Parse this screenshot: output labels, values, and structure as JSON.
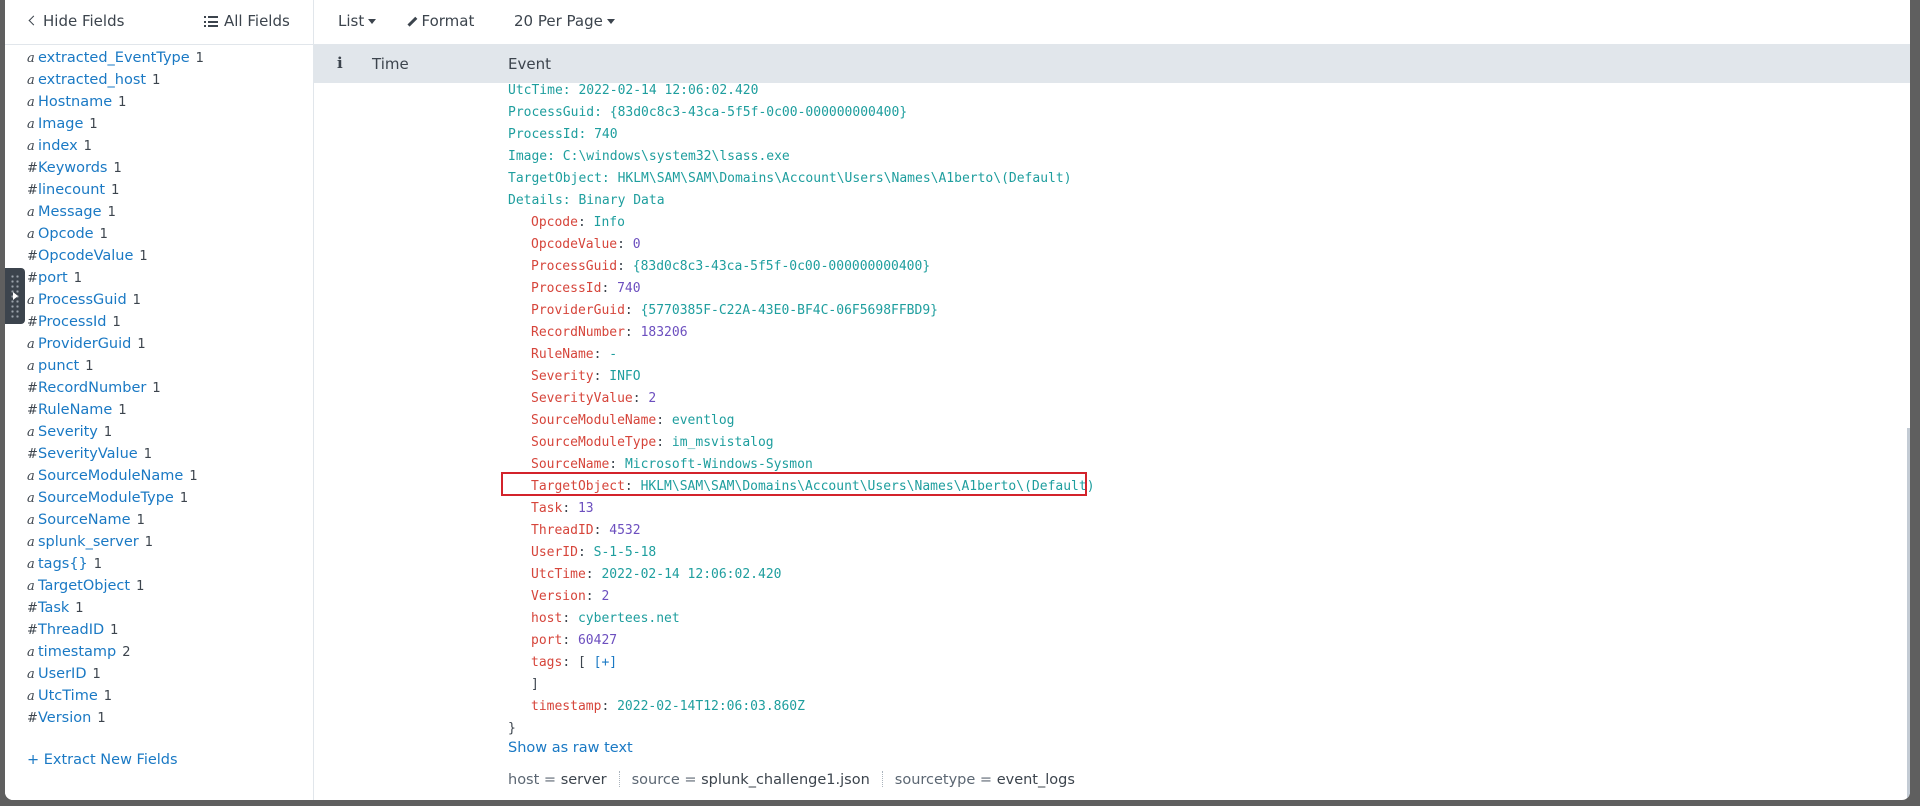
{
  "sidebar": {
    "hide_fields_label": "Hide Fields",
    "all_fields_label": "All Fields",
    "extract_label": "+ Extract New Fields",
    "fields": [
      {
        "type": "a",
        "name": "extracted_EventType",
        "count": "1"
      },
      {
        "type": "a",
        "name": "extracted_host",
        "count": "1"
      },
      {
        "type": "a",
        "name": "Hostname",
        "count": "1"
      },
      {
        "type": "a",
        "name": "Image",
        "count": "1"
      },
      {
        "type": "a",
        "name": "index",
        "count": "1"
      },
      {
        "type": "#",
        "name": "Keywords",
        "count": "1"
      },
      {
        "type": "#",
        "name": "linecount",
        "count": "1"
      },
      {
        "type": "a",
        "name": "Message",
        "count": "1"
      },
      {
        "type": "a",
        "name": "Opcode",
        "count": "1"
      },
      {
        "type": "#",
        "name": "OpcodeValue",
        "count": "1"
      },
      {
        "type": "#",
        "name": "port",
        "count": "1"
      },
      {
        "type": "a",
        "name": "ProcessGuid",
        "count": "1"
      },
      {
        "type": "#",
        "name": "ProcessId",
        "count": "1"
      },
      {
        "type": "a",
        "name": "ProviderGuid",
        "count": "1"
      },
      {
        "type": "a",
        "name": "punct",
        "count": "1"
      },
      {
        "type": "#",
        "name": "RecordNumber",
        "count": "1"
      },
      {
        "type": "#",
        "name": "RuleName",
        "count": "1"
      },
      {
        "type": "a",
        "name": "Severity",
        "count": "1"
      },
      {
        "type": "#",
        "name": "SeverityValue",
        "count": "1"
      },
      {
        "type": "a",
        "name": "SourceModuleName",
        "count": "1"
      },
      {
        "type": "a",
        "name": "SourceModuleType",
        "count": "1"
      },
      {
        "type": "a",
        "name": "SourceName",
        "count": "1"
      },
      {
        "type": "a",
        "name": "splunk_server",
        "count": "1"
      },
      {
        "type": "a",
        "name": "tags{}",
        "count": "1"
      },
      {
        "type": "a",
        "name": "TargetObject",
        "count": "1"
      },
      {
        "type": "#",
        "name": "Task",
        "count": "1"
      },
      {
        "type": "#",
        "name": "ThreadID",
        "count": "1"
      },
      {
        "type": "a",
        "name": "timestamp",
        "count": "2"
      },
      {
        "type": "a",
        "name": "UserID",
        "count": "1"
      },
      {
        "type": "a",
        "name": "UtcTime",
        "count": "1"
      },
      {
        "type": "#",
        "name": "Version",
        "count": "1"
      }
    ]
  },
  "toolbar": {
    "list_label": "List",
    "format_label": "Format",
    "per_page_label": "20 Per Page"
  },
  "table_header": {
    "info_label": "i",
    "time_label": "Time",
    "event_label": "Event"
  },
  "event": {
    "plain_lines": [
      "UtcTime: 2022-02-14 12:06:02.420",
      "ProcessGuid: {83d0c8c3-43ca-5f5f-0c00-000000000400}",
      "ProcessId: 740",
      "Image: C:\\windows\\system32\\lsass.exe",
      "TargetObject: HKLM\\SAM\\SAM\\Domains\\Account\\Users\\Names\\A1berto\\(Default)",
      "Details: Binary Data"
    ],
    "kv_lines": [
      {
        "key": "Opcode",
        "value": "Info",
        "vtype": "s"
      },
      {
        "key": "OpcodeValue",
        "value": "0",
        "vtype": "n"
      },
      {
        "key": "ProcessGuid",
        "value": "{83d0c8c3-43ca-5f5f-0c00-000000000400}",
        "vtype": "s"
      },
      {
        "key": "ProcessId",
        "value": "740",
        "vtype": "n"
      },
      {
        "key": "ProviderGuid",
        "value": "{5770385F-C22A-43E0-BF4C-06F5698FFBD9}",
        "vtype": "s"
      },
      {
        "key": "RecordNumber",
        "value": "183206",
        "vtype": "n"
      },
      {
        "key": "RuleName",
        "value": "-",
        "vtype": "s"
      },
      {
        "key": "Severity",
        "value": "INFO",
        "vtype": "s"
      },
      {
        "key": "SeverityValue",
        "value": "2",
        "vtype": "n"
      },
      {
        "key": "SourceModuleName",
        "value": "eventlog",
        "vtype": "s"
      },
      {
        "key": "SourceModuleType",
        "value": "im_msvistalog",
        "vtype": "s"
      },
      {
        "key": "SourceName",
        "value": "Microsoft-Windows-Sysmon",
        "vtype": "s"
      },
      {
        "key": "TargetObject",
        "value": "HKLM\\SAM\\SAM\\Domains\\Account\\Users\\Names\\A1berto\\(Default)",
        "vtype": "s"
      },
      {
        "key": "Task",
        "value": "13",
        "vtype": "n"
      },
      {
        "key": "ThreadID",
        "value": "4532",
        "vtype": "n"
      },
      {
        "key": "UserID",
        "value": "S-1-5-18",
        "vtype": "s"
      },
      {
        "key": "UtcTime",
        "value": "2022-02-14 12:06:02.420",
        "vtype": "s"
      },
      {
        "key": "Version",
        "value": "2",
        "vtype": "n"
      },
      {
        "key": "host",
        "value": "cybertees.net",
        "vtype": "s"
      },
      {
        "key": "port",
        "value": "60427",
        "vtype": "n"
      }
    ],
    "tags_key": "tags",
    "tags_open": "[",
    "tags_expand": "[+]",
    "tags_close": "]",
    "timestamp_key": "timestamp",
    "timestamp_value": "2022-02-14T12:06:03.860Z",
    "close_brace": "}",
    "show_raw_label": "Show as raw text"
  },
  "meta": [
    {
      "key": "host",
      "value": "server"
    },
    {
      "key": "source",
      "value": "splunk_challenge1.json"
    },
    {
      "key": "sourcetype",
      "value": "event_logs"
    }
  ],
  "colors": {
    "key": "#d6453b",
    "string_value": "#1e9e9e",
    "number_value": "#6c4fbf",
    "link": "#1a79c4",
    "highlight_border": "#d3232b"
  }
}
